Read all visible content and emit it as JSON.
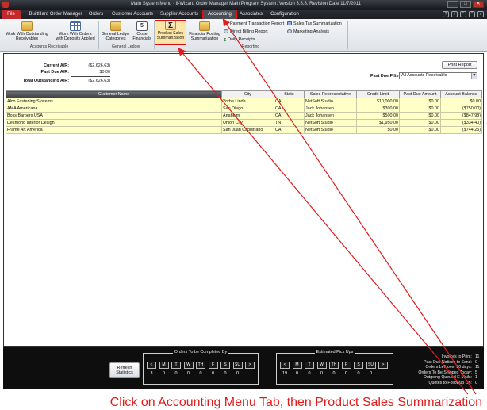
{
  "window": {
    "title": "Main System Menu - ii-Wizard Order Manager Main Program System. Version 3.8.8. Revision Date 11/7/2011",
    "controls": [
      "_",
      "□",
      "✕"
    ]
  },
  "menu": {
    "file": "File",
    "tabs": [
      "BuiltHard Order Manager",
      "Orders",
      "Customer Accounts",
      "Supplier Accounts",
      "Accounting",
      "Associates",
      "Configuration"
    ],
    "active": "Accounting",
    "icons": [
      "help-icon",
      "info-icon",
      "minimize-ribbon-icon",
      "settings-icon",
      "exit-icon"
    ]
  },
  "ribbon": {
    "accounts_receivable": {
      "label": "Accounts Receivable",
      "btn1": [
        "Work With Outstanding",
        "Receivables"
      ],
      "btn2": [
        "Work With Orders",
        "with Deposits Applied"
      ]
    },
    "general_ledger": {
      "label": "General Ledger",
      "btn1": [
        "General Ledger",
        "Categories"
      ],
      "btn2": [
        "Close",
        "Financials"
      ]
    },
    "reporting": {
      "label": "Reporting",
      "btn_product_sales": [
        "Product Sales",
        "Summarization"
      ],
      "btn_financial_posting": [
        "Financial Posting",
        "Summarization"
      ],
      "payment_transaction": "Payment Transaction Report",
      "direct_billing": "Direct Billing Report",
      "daily_receipts": "Daily Receipts",
      "sales_tax": "Sales Tax Summarization",
      "marketing": "Marketing Analysis"
    }
  },
  "summary": {
    "current_ar_label": "Current A/R:",
    "current_ar": "($2,626.63)",
    "past_due_ar_label": "Past Due A/R:",
    "past_due_ar": "$0.00",
    "total_label": "Total Outstanding A/R:",
    "total": "($2,626.63)"
  },
  "print_report": "Print Report",
  "past_due_filter": {
    "label": "Past Due Filter",
    "value": "All Accounts Receivable"
  },
  "grid": {
    "columns": [
      "Customer Name",
      "City",
      "State",
      "Sales Representative",
      "Credit Limit",
      "Past Due Amount",
      "Account Balance"
    ],
    "rows": [
      [
        "Alco Fastening Systems",
        "Yorba Linda",
        "CA",
        "NetSoft Studio",
        "$10,000.00",
        "$0.00",
        "$0.00"
      ],
      [
        "AMA Americana",
        "San Diego",
        "CA",
        "Jack Johansen",
        "$300.00",
        "$0.00",
        "($750.00)"
      ],
      [
        "Boss Barbers USA",
        "Anaheim",
        "CA",
        "Jack Johansen",
        "$500.00",
        "$0.00",
        "($847.98)"
      ],
      [
        "Desmond Interior Design",
        "Union City",
        "TN",
        "NetSoft Studio",
        "$1,950.00",
        "$0.00",
        "($334.40)"
      ],
      [
        "Frame Art America",
        "San Juan Capistrano",
        "CA",
        "NetSoft Studio",
        "$0.00",
        "$0.00",
        "($744.25)"
      ]
    ]
  },
  "footer": {
    "refresh": [
      "Refresh",
      "Statistics"
    ],
    "orders_panel": {
      "title": "Orders To be Completed By",
      "days": [
        "<",
        "M",
        "T",
        "W",
        "TH",
        "F",
        "S",
        "SU",
        ">"
      ],
      "counts": [
        "3",
        "0",
        "0",
        "0",
        "0",
        "0",
        "0",
        "0",
        ""
      ]
    },
    "pickups_panel": {
      "title": "Estimated Pick Ups",
      "days": [
        "<",
        "M",
        "T",
        "W",
        "TH",
        "F",
        "S",
        "SU",
        ">"
      ],
      "counts": [
        "19",
        "0",
        "0",
        "0",
        "0",
        "0",
        "0",
        "0",
        ""
      ]
    },
    "stats": [
      [
        "Invoices to Print:",
        "11"
      ],
      [
        "Past Due Notices to Send:",
        "0"
      ],
      [
        "Orders Left over 30 days:",
        "11"
      ],
      [
        "Orders To Be Shipped Today:",
        "5"
      ],
      [
        "Outgoing Queued E-Mails:",
        "1"
      ],
      [
        "Quotes to Followup On:",
        "0"
      ]
    ]
  },
  "annotation": {
    "caption": "Click on Accounting Menu Tab, then Product Sales Summarization",
    "color": "#e31b1b"
  }
}
